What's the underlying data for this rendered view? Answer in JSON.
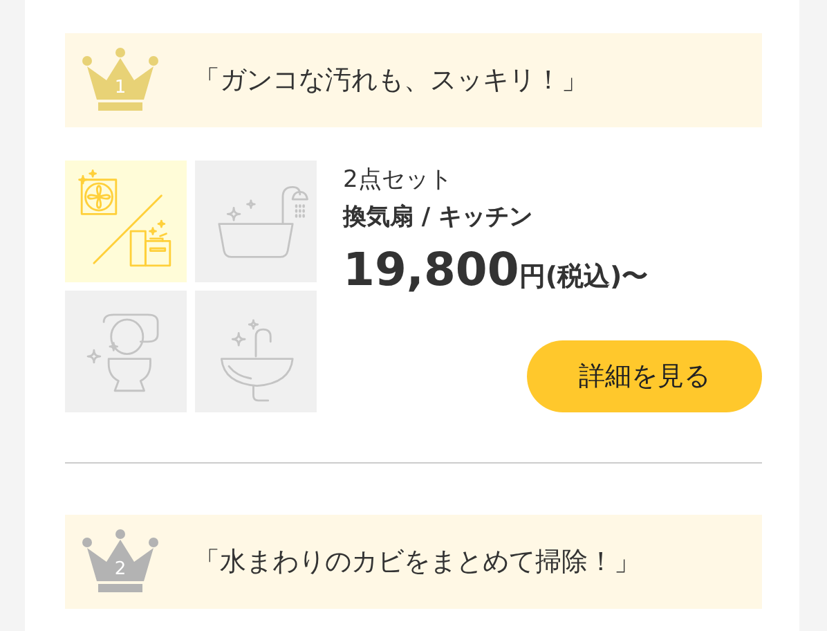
{
  "rankings": [
    {
      "rank": "1",
      "color": "#e8d276",
      "headline": "「ガンコな汚れも、スッキリ！」",
      "product": {
        "set": "2点セット",
        "name": "換気扇 / キッチン",
        "price": "19,800",
        "price_suffix": "円(税込)〜",
        "button": "詳細を見る",
        "tiles": [
          {
            "kind": "fan-kitchen",
            "selected": true
          },
          {
            "kind": "bath",
            "selected": false
          },
          {
            "kind": "toilet",
            "selected": false
          },
          {
            "kind": "sink",
            "selected": false
          }
        ]
      }
    },
    {
      "rank": "2",
      "color": "#b3b3b3",
      "headline": "「水まわりのカビをまとめて掃除！」"
    }
  ]
}
